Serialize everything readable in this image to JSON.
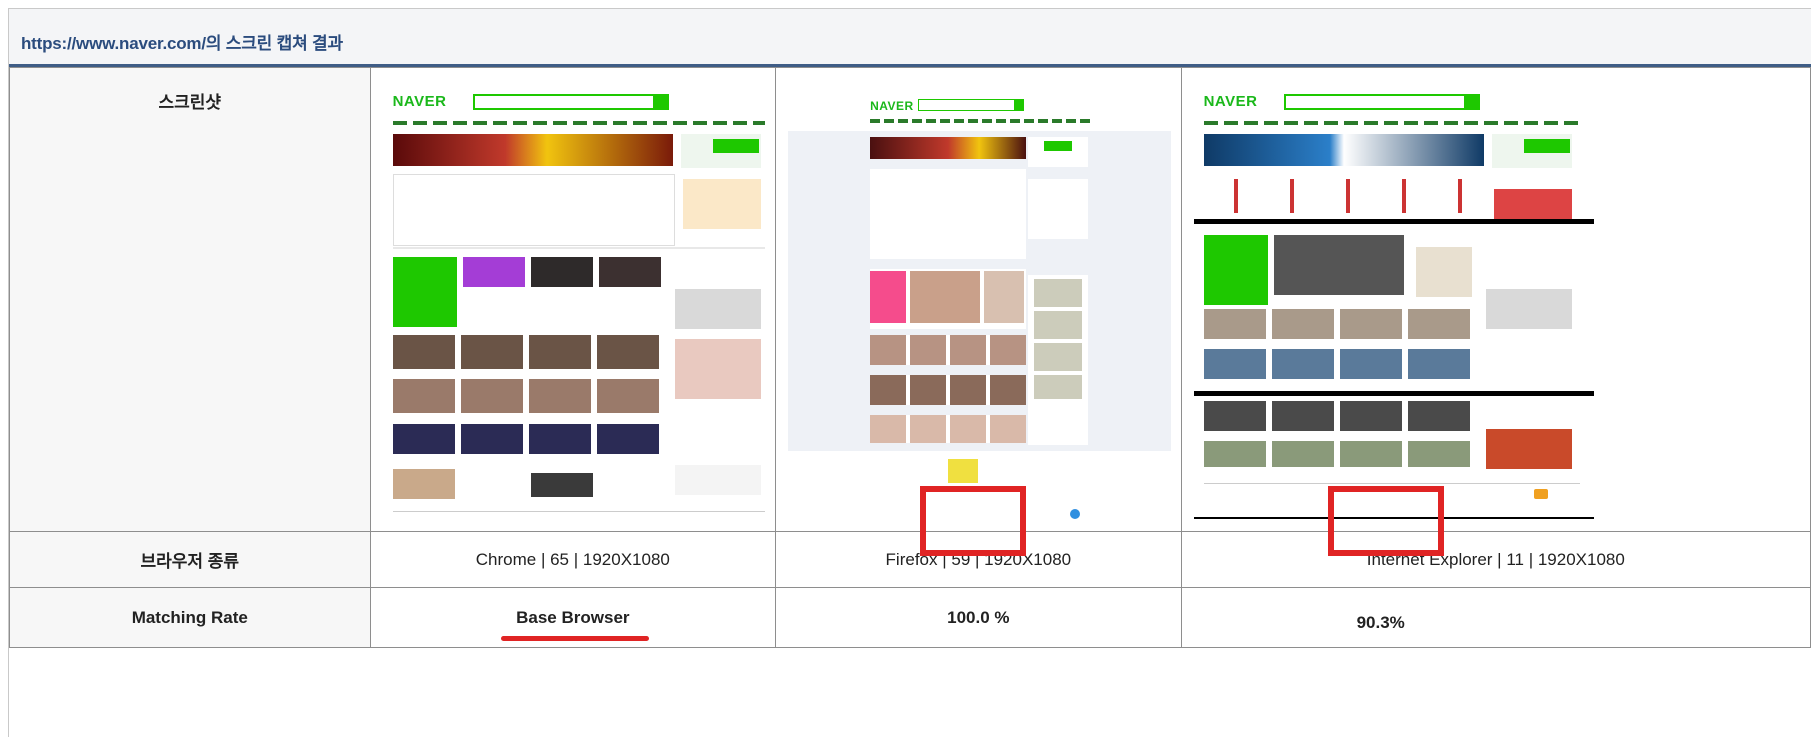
{
  "page": {
    "title": "https://www.naver.com/의 스크린 캡쳐 결과"
  },
  "rows": {
    "screenshot_label": "스크린샷",
    "browser_label": "브라우저 종류",
    "matching_label": "Matching Rate"
  },
  "columns": [
    {
      "browser": "Chrome | 65 | 1920X1080",
      "matching": "Base Browser",
      "logo": "NAVER"
    },
    {
      "browser": "Firefox | 59 | 1920X1080",
      "matching": "100.0 %",
      "logo": "NAVER"
    },
    {
      "browser": "Internet Explorer | 11 | 1920X1080",
      "matching": "90.3%",
      "logo": "NAVER"
    }
  ],
  "colors": {
    "highlight": "#e02424",
    "header_text": "#2b4c7e",
    "naver_green": "#1ec800"
  }
}
